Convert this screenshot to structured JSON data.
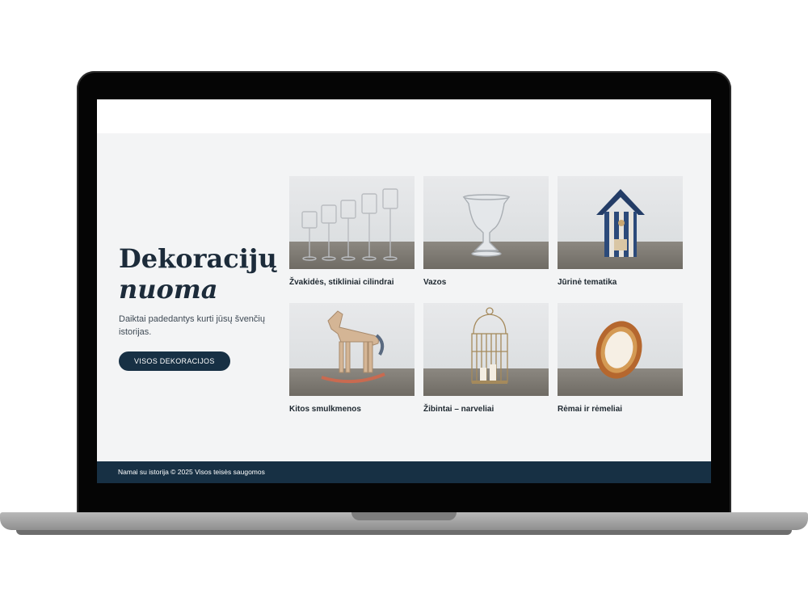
{
  "hero": {
    "title_line1": "Dekoracijų",
    "title_line2": "nuoma",
    "description": "Daiktai padedantys kurti jūsų švenčių istorijas.",
    "button_label": "VISOS DEKORACIJOS"
  },
  "categories": [
    {
      "label": "Žvakidės, stikliniai cilindrai",
      "icon": "candle-holders-image"
    },
    {
      "label": "Vazos",
      "icon": "vase-image"
    },
    {
      "label": "Jūrinė tematika",
      "icon": "nautical-house-image"
    },
    {
      "label": "Kitos smulkmenos",
      "icon": "rocking-horse-image"
    },
    {
      "label": "Žibintai – narveliai",
      "icon": "birdcage-lantern-image"
    },
    {
      "label": "Rėmai ir rėmeliai",
      "icon": "frame-image"
    }
  ],
  "footer": {
    "text": "Namai su istorija © 2025 Visos teisės saugomos"
  },
  "colors": {
    "accent": "#173044",
    "page_bg": "#f3f4f5"
  }
}
